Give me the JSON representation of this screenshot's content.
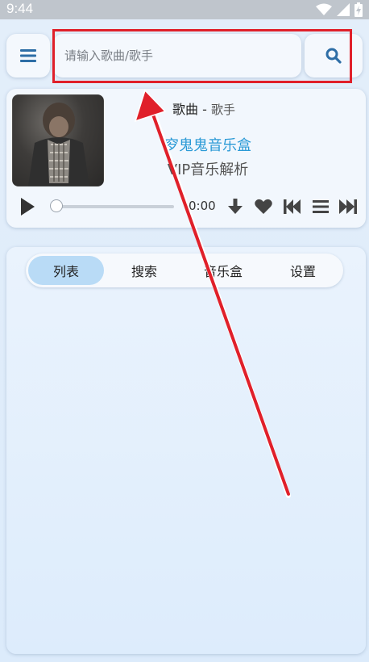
{
  "status_bar": {
    "time": "9:44"
  },
  "header": {
    "menu_icon": "hamburger-menu-icon",
    "search": {
      "placeholder": "请输入歌曲/歌手",
      "value": ""
    },
    "search_icon": "search-icon"
  },
  "player": {
    "song_title": "歌曲",
    "separator": " - ",
    "artist": "歌手",
    "app_name": "穸鬼鬼音乐盒",
    "app_subtitle": "VIP音乐解析",
    "current_time": "0:00",
    "progress": 0,
    "controls": [
      "play-icon",
      "download-icon",
      "heart-icon",
      "previous-icon",
      "playlist-icon",
      "next-icon"
    ]
  },
  "tabs": {
    "items": [
      {
        "label": "列表",
        "active": true
      },
      {
        "label": "搜索",
        "active": false
      },
      {
        "label": "音乐盒",
        "active": false
      },
      {
        "label": "设置",
        "active": false
      }
    ]
  },
  "colors": {
    "accent": "#2b9ad6",
    "highlight": "#e0202a",
    "tab_active": "#b9dbf6"
  }
}
